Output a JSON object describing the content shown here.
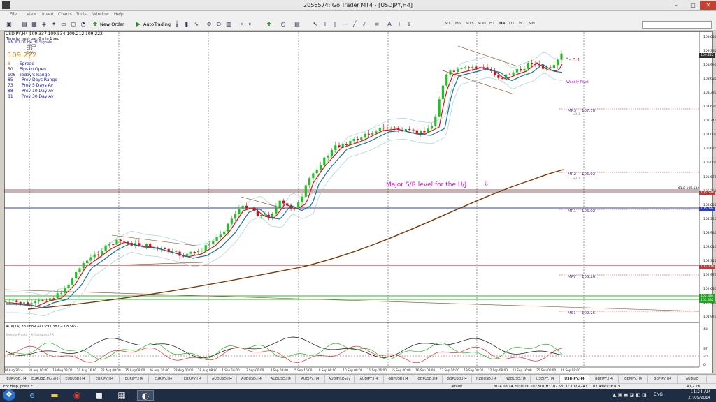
{
  "window": {
    "title": "2056574: Go Trader MT4 - [USDJPY,H4]"
  },
  "menu": [
    "File",
    "View",
    "Insert",
    "Charts",
    "Tools",
    "Window",
    "Help"
  ],
  "toolbar": {
    "new_order": "New Order",
    "autotrading": "AutoTrading",
    "timeframes": [
      "M1",
      "M5",
      "M15",
      "M30",
      "H1",
      "H4",
      "D1",
      "W1",
      "MN"
    ]
  },
  "chart": {
    "symbol_header": "USDJPY,H4  109.337 109.534 109.212 109.222",
    "timer": "Time for next bar: 0 min 1 sec",
    "tf_row": "MN  W1  D1  H4  H1  Signals",
    "ind_names": [
      "MACD",
      "STR",
      "EMA"
    ],
    "price_big": "109.222",
    "stats": [
      {
        "v": "8",
        "l": "Spread"
      },
      {
        "v": "50",
        "l": "Pips to Open"
      },
      {
        "v": "106",
        "l": "Today's Range"
      },
      {
        "v": "85",
        "l": "Prev Days Range"
      },
      {
        "v": "73",
        "l": "Prev 5 Days Av"
      },
      {
        "v": "88",
        "l": "Prev 10 Day Av"
      },
      {
        "v": "81",
        "l": "Prev 30 Day Av"
      }
    ],
    "annotation": "Major S/R level for the U/J",
    "weekly_pivot": "Weekly Pivot",
    "ratio": "^- 0:1",
    "fib": "61.8 105.534",
    "pivots": [
      {
        "l": "MR3",
        "v": "107.78"
      },
      {
        "l": "MR2",
        "v": "106.02"
      },
      {
        "l": "MR1",
        "v": "105.02"
      },
      {
        "l": "MPV",
        "v": "103.26"
      },
      {
        "l": "MS1",
        "v": "102.26"
      }
    ],
    "pivot_sub": [
      "w3.1",
      "w2.1"
    ],
    "watermark": "Weekly Pivots | ® Compass FX",
    "y_labels": [
      "109.650",
      "109.380",
      "108.990",
      "108.680",
      "108.330",
      "107.680",
      "107.340",
      "107.000",
      "106.670",
      "106.000",
      "105.670",
      "105.330",
      "104.650",
      "104.320",
      "103.980",
      "103.640",
      "103.310",
      "102.970",
      "102.630",
      "102.300",
      "101.970"
    ],
    "price_labels": [
      {
        "v": "109.222",
        "c": "#303030"
      },
      {
        "v": "105.590",
        "c": "#b04040"
      },
      {
        "v": "105.084",
        "c": "#3040b0"
      },
      {
        "v": "103.000",
        "c": "#b04040"
      },
      {
        "v": "102.484",
        "c": "#20a020"
      },
      {
        "v": "102.332",
        "c": "#20a020"
      }
    ],
    "adx_header": "ADX(14) 33.0689 +DI:29.0387 -DI:8.5692",
    "adx_y": [
      "48",
      "37",
      "20",
      "0"
    ],
    "x_labels": [
      "14 Aug 2014",
      "18 Aug 00:00",
      "19 Aug 08:00",
      "20 Aug 16:00",
      "22 Aug 00:00",
      "25 Aug 08:00",
      "26 Aug 16:00",
      "28 Aug 00:00",
      "29 Aug 08:00",
      "1 Sep 16:00",
      "3 Sep 00:00",
      "4 Sep 08:00",
      "5 Sep 16:00",
      "9 Sep 00:00",
      "10 Sep 08:00",
      "11 Sep 16:00",
      "15 Sep 00:00",
      "16 Sep 08:00",
      "17 Sep 16:00",
      "19 Sep 00:00",
      "22 Sep 08:00",
      "23 Sep 16:00",
      "25 Sep 00:00",
      "26 Sep 08:00"
    ]
  },
  "tabs": [
    "EURUSD,H4",
    "EURUSD,Monthly",
    "EURUSD,H4",
    "EURJPY,H4",
    "EURJPY,H4",
    "EURJPY,H4",
    "EURJPY,H4",
    "AUDUSD,H4",
    "AUDUSD,H4",
    "AUDUSD,H4",
    "AUDJPY,H4",
    "AUDJPY,Daily",
    "AUDJPY,H4",
    "GBPUSD,H4",
    "GBPUSD,H4",
    "GBPUSD,H4",
    "NZDUSD,H4",
    "NZDUSD,H4",
    "USDJPY,H4",
    "USDJPY,H4",
    "GBPJPY,H4",
    "GBPJPY,H4",
    "GBPJPY,H4",
    "AUDNZ"
  ],
  "status": {
    "help": "For Help, press F1",
    "profile": "Default",
    "ohlc": "2014.08.14 20:00   O: 102.501   H: 102.531   L: 102.424   C: 102.439   V: 6703",
    "traffic": "40/2 kb"
  },
  "taskbar": {
    "lang": "ENG",
    "time": "11:24 AM",
    "date": "27/09/2014"
  },
  "colors": {
    "candle_up": "#22c022",
    "candle_down": "#cc1010",
    "ema_fast": "#d01818",
    "ema_slow": "#1a6fa0",
    "sma_long": "#7a3a08",
    "bollinger": "#a8d8e0"
  }
}
